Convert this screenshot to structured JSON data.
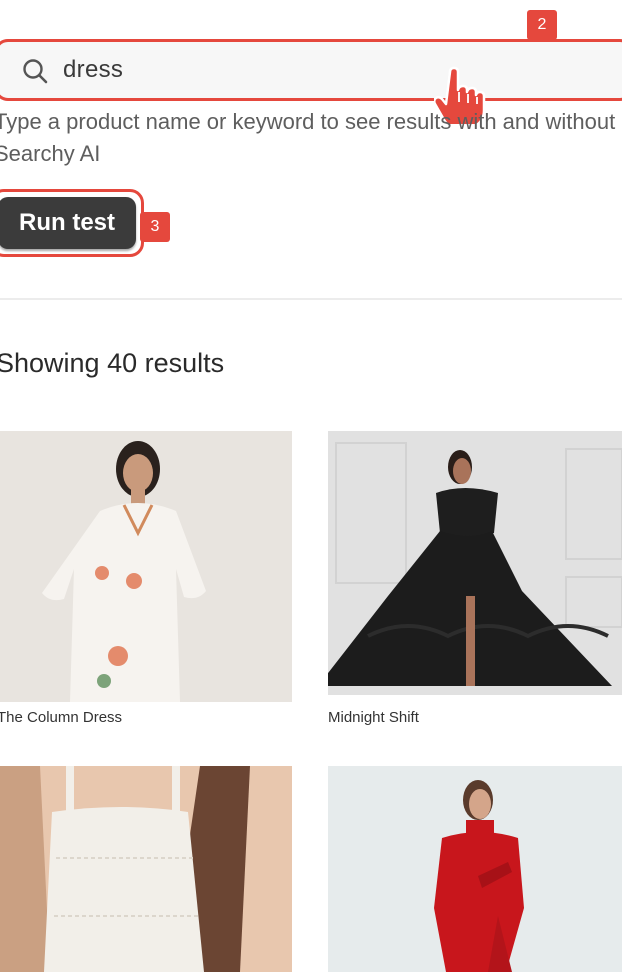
{
  "search": {
    "value": "dress",
    "helper_text": "Type a product name or keyword to see results with and without Searchy AI"
  },
  "annotations": {
    "step_2": "2",
    "step_3": "3"
  },
  "run_button": {
    "label": "Run test"
  },
  "results": {
    "count_text": "Showing 40 results",
    "products": [
      {
        "title": "The Column Dress"
      },
      {
        "title": "Midnight Shift"
      },
      {
        "title": ""
      },
      {
        "title": ""
      }
    ]
  },
  "colors": {
    "highlight": "#e5483d",
    "button_bg": "#3b3b3b"
  }
}
